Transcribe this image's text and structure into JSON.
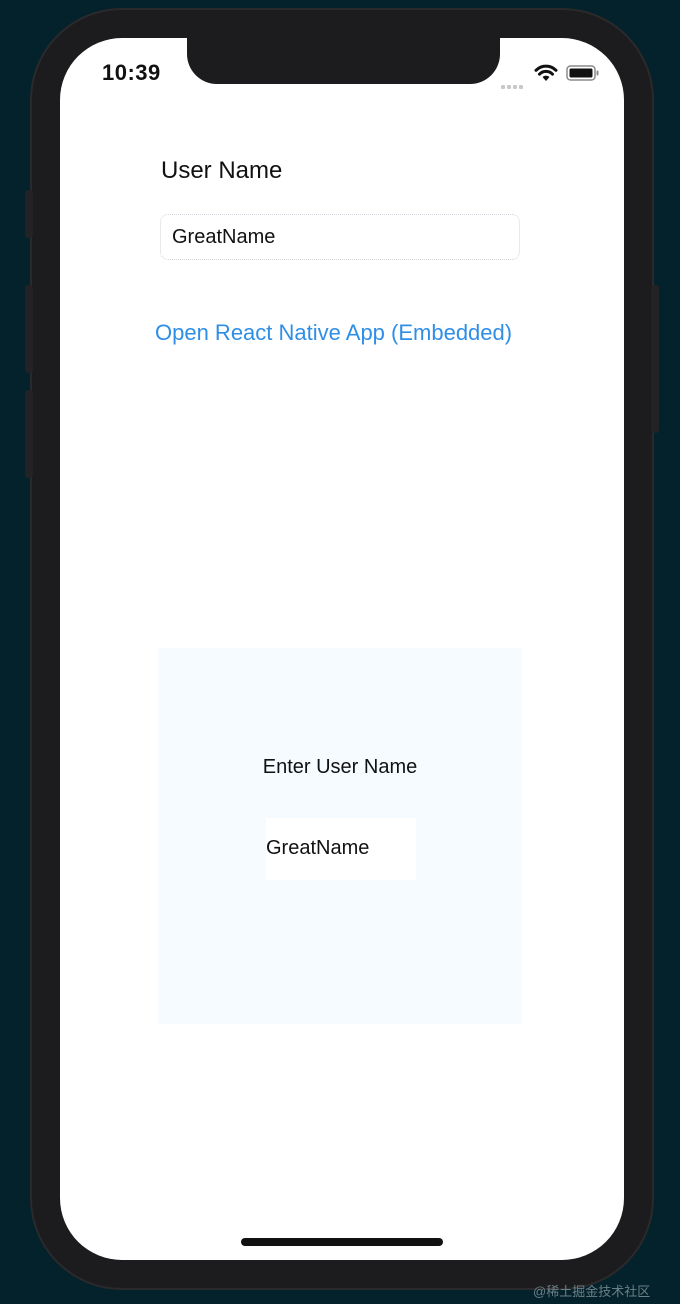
{
  "status_bar": {
    "time": "10:39",
    "icons": [
      "cellular-signal-icon",
      "wifi-icon",
      "battery-icon"
    ]
  },
  "native_form": {
    "username_label": "User Name",
    "username_value": "GreatName",
    "open_link": "Open React Native App (Embedded)"
  },
  "react_native_view": {
    "label": "Enter User Name",
    "input_value": "GreatName"
  },
  "watermark": "@稀土掘金技术社区",
  "colors": {
    "background": "#04222b",
    "link": "#2f8ee6",
    "rn_panel": "#f5fbfe"
  }
}
